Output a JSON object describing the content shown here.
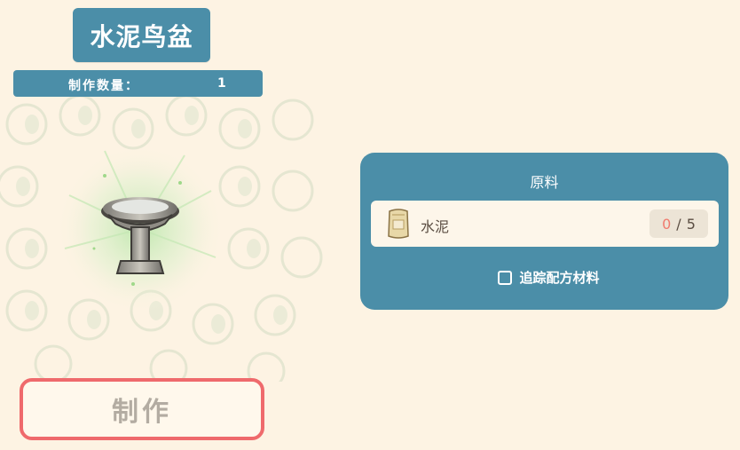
{
  "item": {
    "title": "水泥鸟盆",
    "quantity_label": "制作数量：",
    "quantity_value": "1"
  },
  "craft_button": {
    "label": "制作"
  },
  "materials_panel": {
    "header": "原料",
    "materials": [
      {
        "name": "水泥",
        "icon": "cement-bag-icon",
        "have": "0",
        "separator": "/",
        "need": "5"
      }
    ],
    "track_label": "追踪配方材料"
  },
  "colors": {
    "panel_blue": "#4b8ea8",
    "craft_border": "#ef6a6c",
    "count_missing": "#f07b6e",
    "background": "#fdf3e3"
  }
}
